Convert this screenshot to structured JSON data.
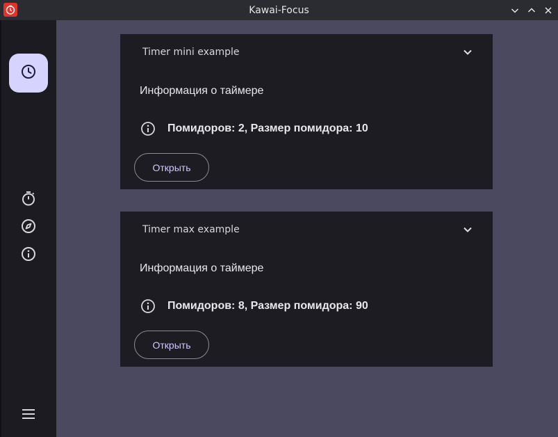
{
  "window": {
    "title": "Kawai-Focus"
  },
  "colors": {
    "accent": "#d6d3ff",
    "background": "#4a4960",
    "surface": "#1d1c22",
    "rail": "#1c1b21",
    "button_text": "#cfc9ff"
  },
  "nav": {
    "items": [
      {
        "icon": "clock-icon",
        "active": true
      },
      {
        "icon": "stopwatch-icon",
        "active": false
      },
      {
        "icon": "compass-icon",
        "active": false
      },
      {
        "icon": "info-icon",
        "active": false
      }
    ],
    "menu_icon": "menu-icon"
  },
  "timers": [
    {
      "title": "Timer mini example",
      "info_heading": "Информация о таймере",
      "info_text": "Помидоров: 2, Размер помидора: 10",
      "open_label": "Открыть"
    },
    {
      "title": "Timer max example",
      "info_heading": "Информация о таймере",
      "info_text": "Помидоров: 8, Размер помидора: 90",
      "open_label": "Открыть"
    }
  ]
}
